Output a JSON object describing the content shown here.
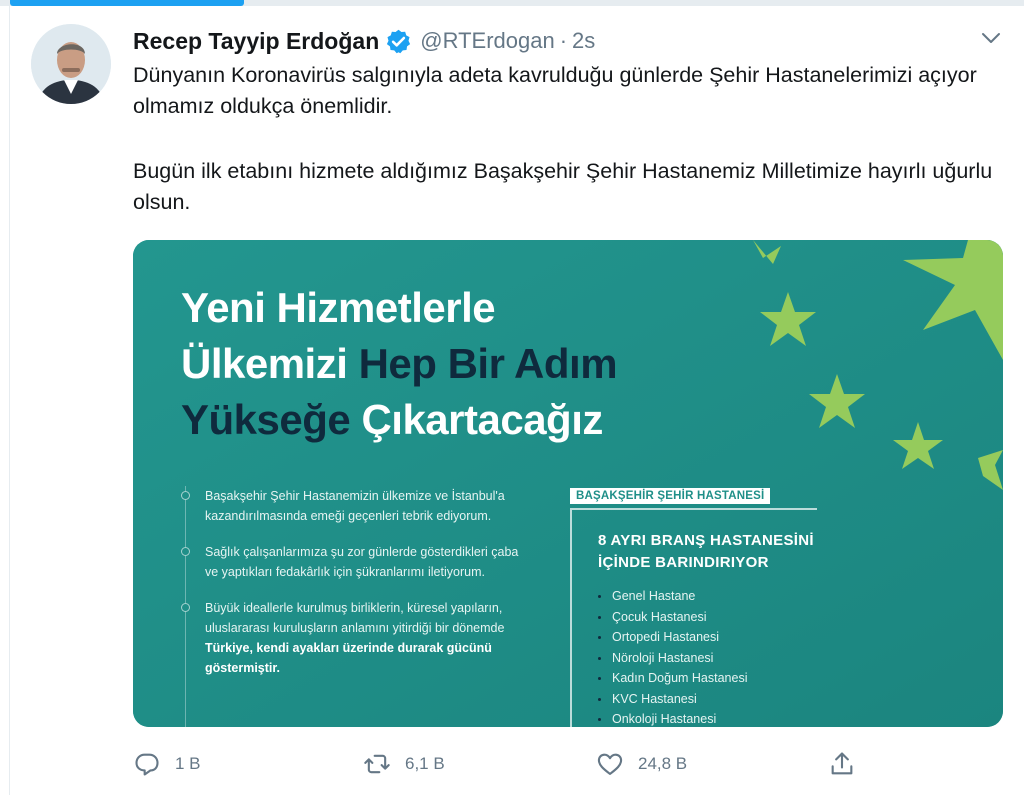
{
  "tweet": {
    "author_name": "Recep Tayyip Erdoğan",
    "handle": "@RTErdogan",
    "separator": "·",
    "time": "2s",
    "paragraph1": "Dünyanın Koronavirüs salgınıyla adeta kavrulduğu günlerde Şehir Hastanelerimizi açıyor olmamız oldukça önemlidir.",
    "paragraph2": "Bugün ilk etabını hizmete aldığımız Başakşehir Şehir Hastanemiz Milletimize hayırlı uğurlu olsun."
  },
  "card": {
    "headline_line1": "Yeni Hizmetlerle",
    "headline_line2_white": "Ülkemizi",
    "headline_line2_dark": "Hep Bir Adım",
    "headline_line3_dark": "Yükseğe",
    "headline_line3_white": "Çıkartacağız",
    "bullets": [
      "Başakşehir Şehir Hastanemizin ülkemize ve İstanbul'a kazandırılmasında emeği geçenleri tebrik ediyorum.",
      "Sağlık çalışanlarımıza şu zor günlerde gösterdikleri çaba ve yaptıkları fedakârlık için şükranlarımı iletiyorum."
    ],
    "bullet3_text": "Büyük ideallerle kurulmuş birliklerin, küresel yapıların, uluslararası kuruluşların anlamını yitirdiği bir dönemde",
    "bullet3_bold": "Türkiye, kendi ayakları üzerinde durarak gücünü göstermiştir.",
    "panel_tag": "BAŞAKŞEHİR ŞEHİR HASTANESİ",
    "panel_title_line1": "8 AYRI BRANŞ HASTANESİNİ",
    "panel_title_line2": "İÇİNDE BARINDIRIYOR",
    "hospitals": [
      "Genel Hastane",
      "Çocuk Hastanesi",
      "Ortopedi Hastanesi",
      "Nöroloji Hastanesi",
      "Kadın Doğum Hastanesi",
      "KVC Hastanesi",
      "Onkoloji Hastanesi"
    ]
  },
  "actions": {
    "reply_count": "1 B",
    "retweet_count": "6,1 B",
    "like_count": "24,8 B"
  },
  "colors": {
    "accent": "#1da1f2",
    "card_teal": "#1f8f88",
    "headline_dark": "#0f2a3d",
    "star_green": "#9ccf5a",
    "muted": "#657786"
  },
  "icons": [
    "verified-badge-icon",
    "chevron-down-icon",
    "reply-icon",
    "retweet-icon",
    "like-icon",
    "share-icon"
  ]
}
